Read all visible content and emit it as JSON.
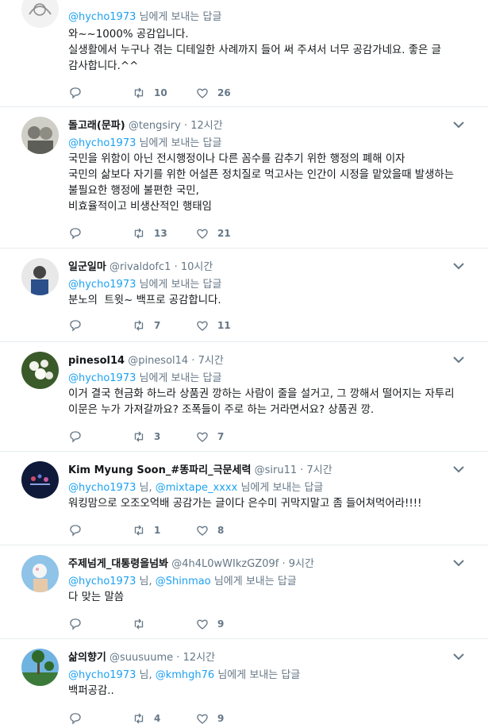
{
  "tweets": [
    {
      "name": "",
      "handle": "",
      "time": "",
      "reply_prefix": "",
      "reply_handles": [
        "@hycho1973"
      ],
      "reply_suffix": "님에게 보내는 답글",
      "text": "와~~1000% 공감입니다.\n실생활에서 누구나 겪는 디테일한 사례까지 들어 써 주셔서 너무 공감가네요. 좋은 글 감사합니다.^^",
      "retweets": "10",
      "likes": "26"
    },
    {
      "name": "돌고래(문파)",
      "handle": "@tengsiry",
      "time": "12시간",
      "reply_handles": [
        "@hycho1973"
      ],
      "reply_suffix": "님에게 보내는 답글",
      "text": "국민을 위함이 아닌 전시행정이나 다른 꼼수를 감추기 위한 행정의 폐해 이자\n국민의 삶보다 자기를 위한 어설픈 정치질로 먹고사는 인간이 시정을 맡았을때 발생하는 불필요한 행정에 불편한 국민,\n비효율적이고 비생산적인 행태임",
      "retweets": "13",
      "likes": "21"
    },
    {
      "name": "일군일마",
      "handle": "@rivaldofc1",
      "time": "10시간",
      "reply_handles": [
        "@hycho1973"
      ],
      "reply_suffix": "님에게 보내는 답글",
      "text": "분노의  트윗~ 백프로 공감합니다.",
      "retweets": "7",
      "likes": "11"
    },
    {
      "name": "pinesol14",
      "handle": "@pinesol14",
      "time": "7시간",
      "reply_handles": [
        "@hycho1973"
      ],
      "reply_suffix": "님에게 보내는 답글",
      "text": "이거 결국 현금화 하느라 상품권 깡하는 사람이 줄을 설거고, 그 깡해서 떨어지는 자투리 이문은 누가 가져갈까요? 조폭들이 주로 하는 거라면서요? 상품권 깡.",
      "retweets": "3",
      "likes": "7"
    },
    {
      "name": "Kim Myung Soon_#똥파리_극문세력",
      "handle": "@siru11",
      "time": "7시간",
      "reply_handles": [
        "@hycho1973",
        "@mixtape_xxxx"
      ],
      "reply_suffix": "님에게 보내는 답글",
      "text": "워킹맘으로 오조오억배 공감가는 글이다 은수미 귀막지말고 좀 들어쳐먹어라!!!!",
      "retweets": "1",
      "likes": "8"
    },
    {
      "name": "주제넘게_대통령을넘봐",
      "handle": "@4h4L0wWIkzGZ09f",
      "time": "9시간",
      "reply_handles": [
        "@hycho1973",
        "@Shinmao"
      ],
      "reply_suffix": "님에게 보내는 답글",
      "text": "다 맞는 말씀",
      "retweets": "",
      "likes": "9"
    },
    {
      "name": "삶의향기",
      "handle": "@suusuume",
      "time": "12시간",
      "reply_handles": [
        "@hycho1973",
        "@kmhgh76"
      ],
      "reply_suffix": "님에게 보내는 답글",
      "text": "백퍼공감..",
      "retweets": "4",
      "likes": "9"
    }
  ],
  "separator": "·",
  "handle_joiner": "님,",
  "colors": {
    "accent": "#1da1f2",
    "muted": "#657786",
    "text": "#14171a",
    "border": "#e6ecf0"
  },
  "icons": {
    "reply": "reply-icon",
    "retweet": "retweet-icon",
    "like": "heart-icon",
    "menu": "chevron-down-icon"
  }
}
